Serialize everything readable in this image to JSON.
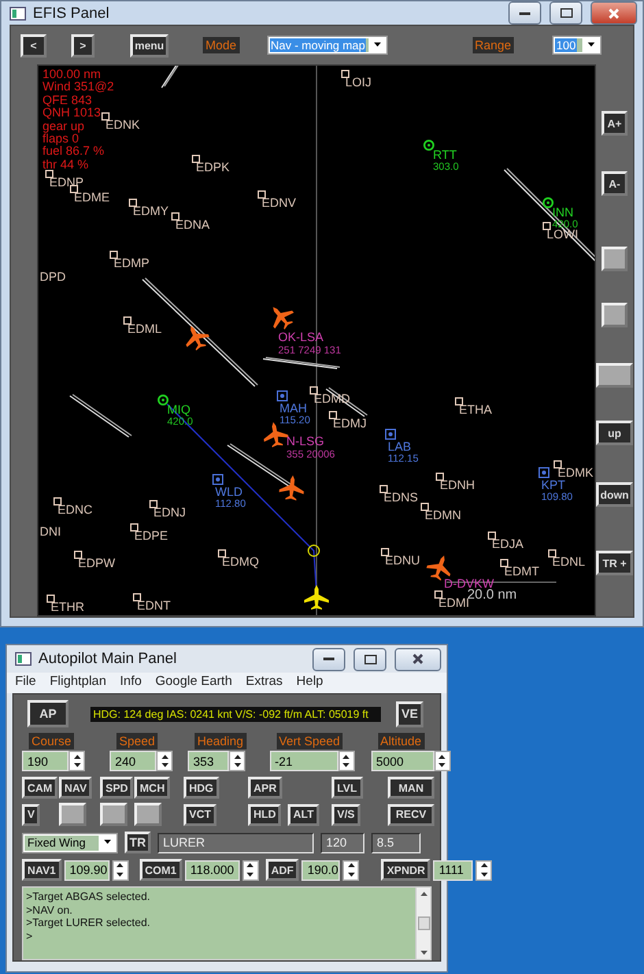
{
  "efis": {
    "title": "EFIS Panel",
    "nav_buttons": [
      "<",
      ">",
      "menu"
    ],
    "mode_label": "Mode",
    "mode": {
      "value": "Nav - moving map"
    },
    "range_label": "Range",
    "range": {
      "value": "100"
    },
    "side_buttons": [
      {
        "kind": "text",
        "label": "A+"
      },
      {
        "kind": "text",
        "label": "A-"
      },
      {
        "kind": "blank"
      },
      {
        "kind": "blank"
      },
      {
        "kind": "blank"
      },
      {
        "kind": "text",
        "label": "up"
      },
      {
        "kind": "text",
        "label": "down"
      },
      {
        "kind": "text",
        "label": "TR +"
      }
    ],
    "map": {
      "info_lines": [
        "100.00 nm",
        "Wind 351@2",
        "QFE 843",
        "QNH 1013",
        "gear up",
        "flaps 0",
        "fuel 86.7 %",
        "thr 44 %"
      ],
      "airports": [
        {
          "name": "EDNK"
        },
        {
          "name": "EDPK"
        },
        {
          "name": "LOIJ"
        },
        {
          "name": "EDNP"
        },
        {
          "name": "EDME"
        },
        {
          "name": "EDMY"
        },
        {
          "name": "EDNA"
        },
        {
          "name": "EDNV"
        },
        {
          "name": "EDMP"
        },
        {
          "name": "EDML"
        },
        {
          "name": "EDMD"
        },
        {
          "name": "ETHA"
        },
        {
          "name": "EDMJ"
        },
        {
          "name": "EDNH"
        },
        {
          "name": "EDNS"
        },
        {
          "name": "EDMN"
        },
        {
          "name": "EDMK"
        },
        {
          "name": "EDNC"
        },
        {
          "name": "EDNJ"
        },
        {
          "name": "EDPE"
        },
        {
          "name": "EDPW"
        },
        {
          "name": "EDMQ"
        },
        {
          "name": "EDNU"
        },
        {
          "name": "EDJA"
        },
        {
          "name": "EDMT"
        },
        {
          "name": "EDNL"
        },
        {
          "name": "ETHR"
        },
        {
          "name": "EDNT"
        },
        {
          "name": "EDMI"
        },
        {
          "name": "LOWI"
        },
        {
          "name": "DPD"
        },
        {
          "name": "DNI"
        }
      ],
      "ndb_stations": [
        {
          "name": "RTT",
          "freq": "303.0"
        },
        {
          "name": "MIQ",
          "freq": "420.0"
        },
        {
          "name": "INN",
          "freq": "420.0"
        }
      ],
      "vor_stations": [
        {
          "name": "WLD",
          "freq": "112.80"
        },
        {
          "name": "MAH",
          "freq": "115.20"
        },
        {
          "name": "KPT",
          "freq": "109.80"
        },
        {
          "name": "LAB",
          "freq": "112.15"
        }
      ],
      "aircraft": [
        {
          "callsign": "OK-LSA",
          "data": "251 7249 131"
        },
        {
          "callsign": "N-LSG",
          "data": "355 20006"
        },
        {
          "callsign": "D-DVKW"
        }
      ],
      "scale": "20.0 nm"
    }
  },
  "autopilot": {
    "title": "Autopilot Main Panel",
    "menu": [
      "File",
      "Flightplan",
      "Info",
      "Google Earth",
      "Extras",
      "Help"
    ],
    "ap_button": "AP",
    "status": "HDG: 124 deg IAS: 0241 knt V/S: -092 ft/m ALT: 05019 ft",
    "ve_button": "VE",
    "settings": [
      {
        "label": "Course",
        "value": "190"
      },
      {
        "label": "Speed",
        "value": "240"
      },
      {
        "label": "Heading",
        "value": "353"
      },
      {
        "label": "Vert Speed",
        "value": "-21"
      },
      {
        "label": "Altitude",
        "value": "5000"
      }
    ],
    "mode_buttons": [
      {
        "kind": "text",
        "label": "CAM"
      },
      {
        "kind": "text",
        "label": "NAV"
      },
      {
        "kind": "text",
        "label": "SPD"
      },
      {
        "kind": "text",
        "label": "MCH"
      },
      {
        "kind": "text",
        "label": "HDG"
      },
      {
        "kind": "text",
        "label": "APR"
      },
      {
        "kind": "text",
        "label": "LVL"
      },
      {
        "kind": "text",
        "label": "MAN"
      }
    ],
    "hold_buttons": [
      {
        "kind": "text",
        "label": "V"
      },
      {
        "kind": "blank"
      },
      {
        "kind": "blank"
      },
      {
        "kind": "blank"
      },
      {
        "kind": "text",
        "label": "VCT"
      },
      {
        "kind": "text",
        "label": "HLD"
      },
      {
        "kind": "text",
        "label": "ALT"
      },
      {
        "kind": "text",
        "label": "V/S"
      },
      {
        "kind": "text",
        "label": "RECV"
      }
    ],
    "aircraft_type": "Fixed Wing",
    "tr_button": "TR",
    "target": "LURER",
    "field_1": "120",
    "field_2": "8.5",
    "radios": [
      {
        "label": "NAV1",
        "value": "109.90"
      },
      {
        "label": "COM1",
        "value": "118.000"
      },
      {
        "label": "ADF",
        "value": "190.0"
      },
      {
        "label": "XPNDR",
        "value": "1111"
      }
    ],
    "log": [
      ">Target ABGAS selected.",
      ">NAV on.",
      ">Target LURER selected.",
      ">"
    ]
  }
}
